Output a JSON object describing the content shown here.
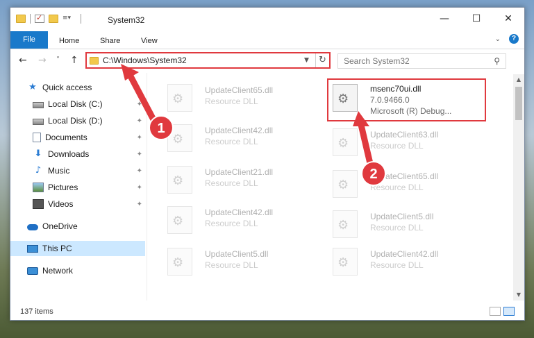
{
  "window": {
    "title": "System32",
    "controls": {
      "minimize": "—",
      "maximize": "☐",
      "close": "✕"
    }
  },
  "ribbon": {
    "tabs": [
      "File",
      "Home",
      "Share",
      "View"
    ],
    "collapse_icon": "chevron-down-icon",
    "help_icon": "?"
  },
  "nav": {
    "back_icon": "←",
    "forward_icon": "→",
    "recent_icon": "˅",
    "up_icon": "↑",
    "address": "C:\\Windows\\System32",
    "address_dropdown_icon": "▼",
    "refresh_icon": "↻",
    "search_placeholder": "Search System32",
    "search_icon": "⚲"
  },
  "sidebar": {
    "items": [
      {
        "label": "Quick access",
        "icon": "star-icon",
        "pinned": false
      },
      {
        "label": "Local Disk (C:)",
        "icon": "disk-icon",
        "pinned": true
      },
      {
        "label": "Local Disk (D:)",
        "icon": "disk-icon",
        "pinned": true
      },
      {
        "label": "Documents",
        "icon": "documents-icon",
        "pinned": true
      },
      {
        "label": "Downloads",
        "icon": "downloads-icon",
        "pinned": true
      },
      {
        "label": "Music",
        "icon": "music-icon",
        "pinned": true
      },
      {
        "label": "Pictures",
        "icon": "pictures-icon",
        "pinned": true
      },
      {
        "label": "Videos",
        "icon": "videos-icon",
        "pinned": true
      },
      {
        "label": "OneDrive",
        "icon": "onedrive-icon",
        "pinned": false
      },
      {
        "label": "This PC",
        "icon": "this-pc-icon",
        "pinned": false,
        "selected": true
      },
      {
        "label": "Network",
        "icon": "network-icon",
        "pinned": false
      }
    ],
    "pin_glyph": "📌"
  },
  "files": {
    "left_column": [
      {
        "name": "UpdateClient65.dll",
        "type": "Resource DLL"
      },
      {
        "name": "UpdateClient42.dll",
        "type": "Resource DLL"
      },
      {
        "name": "UpdateClient21.dll",
        "type": "Resource DLL"
      },
      {
        "name": "UpdateClient42.dll",
        "type": "Resource DLL"
      },
      {
        "name": "UpdateClient5.dll",
        "type": "Resource DLL"
      }
    ],
    "right_column": [
      {
        "name": "msenc70ui.dll",
        "line2": "7.0.9466.0",
        "line3": "Microsoft (R) Debug...",
        "highlighted": true
      },
      {
        "name": "UpdateClient63.dll",
        "type": "Resource DLL"
      },
      {
        "name": "UpdateClient65.dll",
        "type": "Resource DLL"
      },
      {
        "name": "UpdateClient5.dll",
        "type": "Resource DLL"
      },
      {
        "name": "UpdateClient42.dll",
        "type": "Resource DLL"
      }
    ]
  },
  "status": {
    "item_count": "137 items"
  },
  "annotations": {
    "badge1": "1",
    "badge2": "2",
    "color": "#e0393e"
  }
}
